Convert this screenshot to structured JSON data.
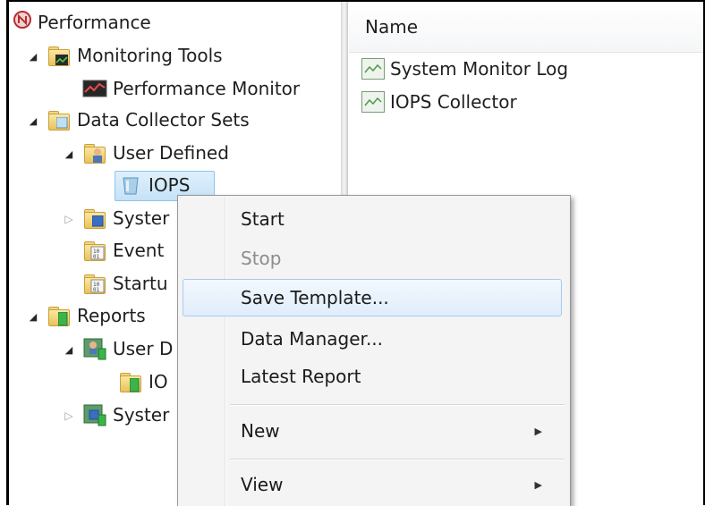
{
  "tree": {
    "root": {
      "label": "Performance",
      "icon": "performance-icon"
    },
    "monitoring_tools": {
      "label": "Monitoring Tools",
      "icon": "monitoring-tools-folder-icon"
    },
    "performance_monitor": {
      "label": "Performance Monitor",
      "icon": "performance-monitor-icon"
    },
    "data_collector_sets": {
      "label": "Data Collector Sets",
      "icon": "data-collector-sets-folder-icon"
    },
    "user_defined": {
      "label": "User Defined",
      "icon": "user-defined-folder-icon"
    },
    "iops": {
      "label": "IOPS",
      "icon": "data-collector-set-icon"
    },
    "system": {
      "label": "Syster",
      "icon": "system-folder-icon"
    },
    "event": {
      "label": "Event",
      "icon": "event-trace-folder-icon"
    },
    "startup": {
      "label": "Startu",
      "icon": "startup-trace-folder-icon"
    },
    "reports": {
      "label": "Reports",
      "icon": "reports-folder-icon"
    },
    "reports_user_defined": {
      "label": "User D",
      "icon": "reports-user-defined-icon"
    },
    "reports_iops": {
      "label": "IO",
      "icon": "report-folder-icon"
    },
    "reports_system": {
      "label": "Syster",
      "icon": "reports-system-icon"
    }
  },
  "list": {
    "column_header": "Name",
    "items": [
      {
        "label": "System Monitor Log",
        "icon": "log-icon"
      },
      {
        "label": "IOPS Collector",
        "icon": "log-icon"
      }
    ]
  },
  "context_menu": {
    "start": "Start",
    "stop": "Stop",
    "save_template": "Save Template...",
    "data_manager": "Data Manager...",
    "latest_report": "Latest Report",
    "new": "New",
    "view": "View"
  },
  "colors": {
    "hover_border": "#a8cbf1",
    "selection_border": "#8ec3ea",
    "folder_yellow": "#e8c25a"
  }
}
